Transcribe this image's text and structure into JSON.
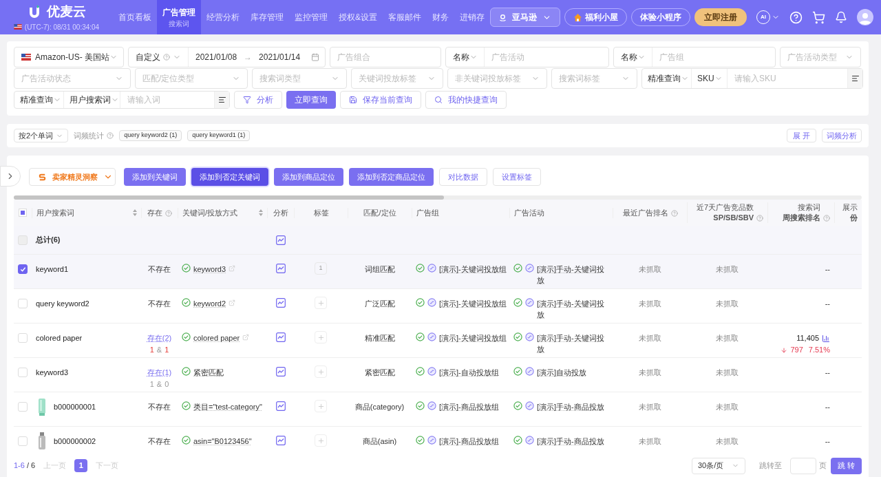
{
  "header": {
    "logo": "优麦云",
    "clock": "(UTC-7): 08/31 00:34:04",
    "nav": [
      {
        "label": "首页看板",
        "selected": false
      },
      {
        "label": "广告管理",
        "selected": true,
        "sub": "搜索词"
      },
      {
        "label": "经营分析",
        "selected": false
      },
      {
        "label": "库存管理",
        "selected": false
      },
      {
        "label": "监控管理",
        "selected": false
      },
      {
        "label": "授权&设置",
        "selected": false
      },
      {
        "label": "客服邮件",
        "selected": false
      },
      {
        "label": "财务",
        "selected": false
      },
      {
        "label": "进销存",
        "selected": false
      }
    ],
    "platform": "亚马逊",
    "welfare": "福利小屋",
    "miniapp": "体验小程序",
    "register": "立即注册",
    "ai": "AI"
  },
  "filters": {
    "row1": {
      "site": "Amazon-US- 美国站",
      "range": "自定义",
      "date_from": "2021/01/08",
      "date_sep": "→",
      "date_to": "2021/01/14",
      "portfolio": {
        "placeholder": "广告组合"
      },
      "campaign_mode": "名称",
      "campaign": {
        "placeholder": "广告活动"
      },
      "group_mode": "名称",
      "group": {
        "placeholder": "广告组"
      },
      "campaign_type": {
        "placeholder": "广告活动类型"
      }
    },
    "row2": {
      "selects": [
        {
          "placeholder": "广告活动状态"
        },
        {
          "placeholder": "匹配/定位类型"
        },
        {
          "placeholder": "搜索词类型"
        },
        {
          "placeholder": "关键词投放标签"
        },
        {
          "placeholder": "非关键词投放标签"
        },
        {
          "placeholder": "搜索词标签"
        }
      ],
      "mode": "精准查询",
      "field": "SKU",
      "input": {
        "placeholder": "请输入SKU"
      }
    },
    "row3": {
      "mode": "精准查询",
      "field": "用户搜索词",
      "input": {
        "placeholder": "请输入词"
      },
      "analyze": "分析",
      "search": "立即查询",
      "save": "保存当前查询",
      "shortcuts": "我的快捷查询"
    }
  },
  "words": {
    "split": "按2个单词",
    "freq_label": "词频统计",
    "tags": [
      "query keyword2 (1)",
      "query keyword1 (1)"
    ],
    "expand": "展 开",
    "analysis": "词频分析"
  },
  "toolbar": {
    "insight": "卖家精灵洞察",
    "buttons": [
      {
        "label": "添加到关键词",
        "kind": "primary",
        "highlighted": false
      },
      {
        "label": "添加到否定关键词",
        "kind": "primary",
        "highlighted": true
      },
      {
        "label": "添加到商品定位",
        "kind": "primary",
        "highlighted": false
      },
      {
        "label": "添加到否定商品定位",
        "kind": "primary",
        "highlighted": false
      },
      {
        "label": "对比数据",
        "kind": "outline",
        "highlighted": false
      },
      {
        "label": "设置标签",
        "kind": "outline",
        "highlighted": false
      }
    ]
  },
  "table": {
    "select_all": {
      "indeterminate": true
    },
    "columns": [
      {
        "label": "用户搜索词",
        "sortable": true
      },
      {
        "label": "存在",
        "help": true
      },
      {
        "label": "关键词/投放方式",
        "sortable": true
      },
      {
        "label": "分析"
      },
      {
        "label": "标签"
      },
      {
        "label": "匹配/定位"
      },
      {
        "label": "广告组"
      },
      {
        "label": "广告活动"
      },
      {
        "label": "最近广告排名",
        "help": true
      },
      {
        "label": "近7天广告竞品数",
        "sub": "SP/SB/SBV",
        "help": true
      },
      {
        "label": "搜索词",
        "sub": "周搜索排名",
        "help": true
      },
      {
        "label": "展示",
        "sub": "份"
      }
    ],
    "total": {
      "label": "总计(6)",
      "disabled": true
    },
    "rows": [
      {
        "kind": "term",
        "term": "keyword1",
        "checked": true,
        "exists": {
          "kind": "none",
          "text": "不存在"
        },
        "keyword": "keyword3",
        "external": true,
        "tag": "1",
        "match": "词组匹配",
        "ad_group": "[演示]-关键词投放组",
        "campaign": "[演示]手动-关键词投放",
        "rank": "未抓取",
        "competitors": "未抓取",
        "search_rank": {
          "kind": "none",
          "text": "--"
        }
      },
      {
        "kind": "term",
        "term": "query keyword2",
        "checked": false,
        "exists": {
          "kind": "none",
          "text": "不存在"
        },
        "keyword": "keyword2",
        "external": true,
        "match": "广泛匹配",
        "ad_group": "[演示]-关键词投放组",
        "campaign": "[演示]手动-关键词投放",
        "rank": "未抓取",
        "competitors": "未抓取",
        "search_rank": {
          "kind": "none",
          "text": "--"
        }
      },
      {
        "kind": "term",
        "term": "colored paper",
        "checked": false,
        "exists": {
          "kind": "link",
          "text": "存在(2)",
          "counts": [
            {
              "value": "1",
              "highlight": true
            },
            {
              "value": "1",
              "highlight": true
            }
          ],
          "joiner": "&"
        },
        "keyword": "colored paper",
        "external": true,
        "match": "精准匹配",
        "ad_group": "[演示]-关键词投放组",
        "campaign": "[演示]手动-关键词投放",
        "rank": "未抓取",
        "competitors": "未抓取",
        "search_rank": {
          "kind": "value",
          "text": "11,405",
          "change": "797",
          "pct": "7.51%"
        }
      },
      {
        "kind": "term",
        "term": "keyword3",
        "checked": false,
        "exists": {
          "kind": "link",
          "text": "存在(1)",
          "counts": [
            {
              "value": "1",
              "highlight": false
            },
            {
              "value": "0",
              "highlight": false
            }
          ],
          "joiner": "&"
        },
        "keyword": "紧密匹配",
        "external": false,
        "match": "紧密匹配",
        "ad_group": "[演示]-自动投放组",
        "campaign": "[演示]自动投放",
        "rank": "未抓取",
        "competitors": "未抓取",
        "search_rank": {
          "kind": "none",
          "text": "--"
        }
      },
      {
        "kind": "product",
        "term": "b000000001",
        "checked": false,
        "exists": {
          "kind": "none",
          "text": "不存在"
        },
        "keyword": "类目=\"test-category\"",
        "external": false,
        "match": "商品(category)",
        "ad_group": "[演示]-商品投放组",
        "campaign": "[演示]手动-商品投放",
        "rank": "未抓取",
        "competitors": "未抓取",
        "search_rank": {
          "kind": "none",
          "text": "--"
        }
      },
      {
        "kind": "product",
        "term": "b000000002",
        "checked": false,
        "exists": {
          "kind": "none",
          "text": "不存在"
        },
        "keyword": "asin=\"B0123456\"",
        "external": false,
        "match": "商品(asin)",
        "ad_group": "[演示]-商品投放组",
        "campaign": "[演示]手动-商品投放",
        "rank": "未抓取",
        "competitors": "未抓取",
        "search_rank": {
          "kind": "none",
          "text": "--"
        }
      }
    ]
  },
  "pagination": {
    "range": "1-6",
    "total": "/ 6",
    "prev": "上一页",
    "pages": [
      {
        "label": "1",
        "selected": true
      }
    ],
    "next": "下一页",
    "page_size": "30条/页",
    "jump_label": "跳转至",
    "page_unit": "页",
    "jump": "跳 转"
  }
}
